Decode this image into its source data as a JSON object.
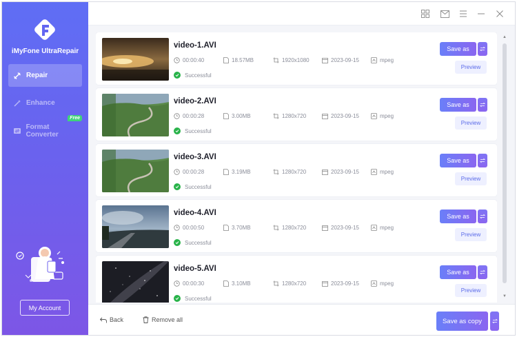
{
  "app": {
    "name": "iMyFone UltraRepair"
  },
  "sidebar": {
    "items": [
      {
        "label": "Repair",
        "icon": "repair-icon",
        "active": true
      },
      {
        "label": "Enhance",
        "icon": "wand-icon",
        "active": false
      },
      {
        "label": "Format Converter",
        "icon": "convert-icon",
        "active": false,
        "badge": "Free"
      }
    ],
    "account_label": "My Account"
  },
  "titlebar": {
    "icons": [
      "grid-icon",
      "mail-icon",
      "menu-icon",
      "minimize-icon",
      "close-icon"
    ]
  },
  "files": [
    {
      "name": "video-1.AVI",
      "duration": "00:00:40",
      "size": "18.57MB",
      "resolution": "1920x1080",
      "date": "2023-09-15",
      "format": "mpeg",
      "status": "Successful",
      "save_label": "Save as",
      "preview_label": "Preview",
      "thumb": "sunset-water"
    },
    {
      "name": "video-2.AVI",
      "duration": "00:00:28",
      "size": "3.00MB",
      "resolution": "1280x720",
      "date": "2023-09-15",
      "format": "mpeg",
      "status": "Successful",
      "save_label": "Save as",
      "preview_label": "Preview",
      "thumb": "green-hill-road"
    },
    {
      "name": "video-3.AVI",
      "duration": "00:00:28",
      "size": "3.19MB",
      "resolution": "1280x720",
      "date": "2023-09-15",
      "format": "mpeg",
      "status": "Successful",
      "save_label": "Save as",
      "preview_label": "Preview",
      "thumb": "green-hill-road"
    },
    {
      "name": "video-4.AVI",
      "duration": "00:00:50",
      "size": "3.70MB",
      "resolution": "1280x720",
      "date": "2023-09-15",
      "format": "mpeg",
      "status": "Successful",
      "save_label": "Save as",
      "preview_label": "Preview",
      "thumb": "cloudy-road"
    },
    {
      "name": "video-5.AVI",
      "duration": "00:00:30",
      "size": "3.10MB",
      "resolution": "1280x720",
      "date": "2023-09-15",
      "format": "mpeg",
      "status": "Successful",
      "save_label": "Save as",
      "preview_label": "Preview",
      "thumb": "night-sky"
    }
  ],
  "footer": {
    "back_label": "Back",
    "remove_label": "Remove all",
    "save_copy_label": "Save as copy"
  },
  "colors": {
    "accent": "#6a7ff8",
    "accent2": "#8a66f0",
    "success": "#29b34a",
    "sidebar_top": "#5f6ef5",
    "sidebar_bottom": "#7d56e6"
  }
}
